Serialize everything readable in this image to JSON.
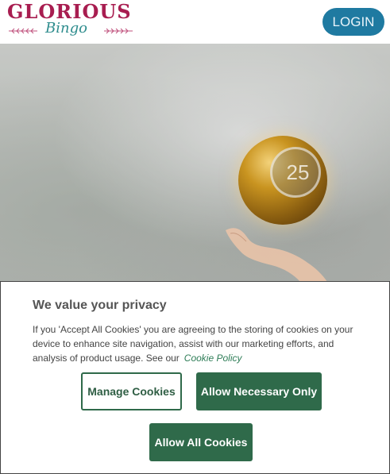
{
  "header": {
    "logo_main": "GLORIOUS",
    "logo_sub": "Bingo",
    "login_label": "LOGIN"
  },
  "hero": {
    "ball_number": "25"
  },
  "cookie_banner": {
    "title": "We value your privacy",
    "text": "If you 'Accept All Cookies' you are agreeing to the storing of cookies on your device to enhance site navigation, assist with our marketing efforts, and analysis of product usage. See our",
    "policy_link": "Cookie Policy",
    "manage_label": "Manage Cookies",
    "necessary_label": "Allow Necessary Only",
    "all_label": "Allow All Cookies"
  },
  "colors": {
    "brand": "#a81d50",
    "accent_teal": "#2f8d8e",
    "login_bg": "#1f7aa1",
    "cookie_green": "#2f6a4a"
  }
}
